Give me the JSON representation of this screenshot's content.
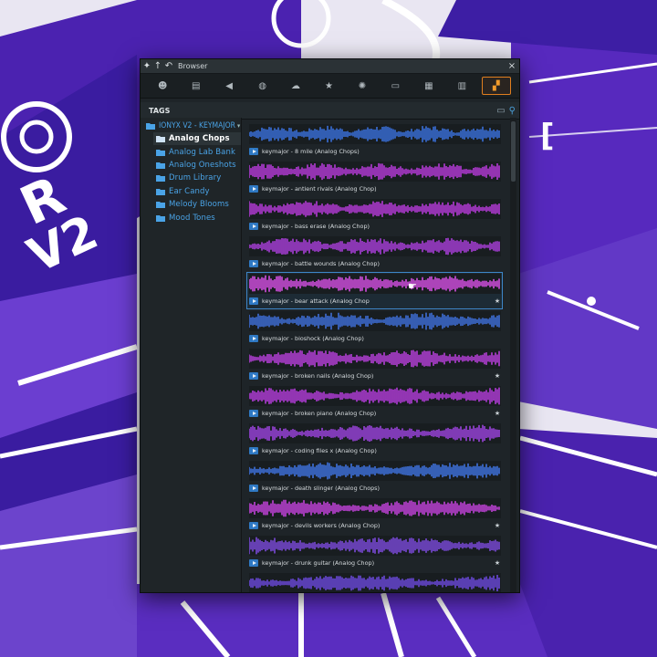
{
  "window": {
    "title": "Browser",
    "close_label": "×"
  },
  "titlebar_icons": [
    {
      "name": "pin-icon",
      "glyph": "✦"
    },
    {
      "name": "up-arrow-icon",
      "glyph": "↑"
    },
    {
      "name": "back-icon",
      "glyph": "↶"
    }
  ],
  "toolbar": [
    {
      "name": "smiley-icon",
      "glyph": "☻",
      "active": false
    },
    {
      "name": "document-icon",
      "glyph": "▤",
      "active": false
    },
    {
      "name": "speaker-icon",
      "glyph": "◀",
      "active": false
    },
    {
      "name": "globe-icon",
      "glyph": "◍",
      "active": false
    },
    {
      "name": "cloud-icon",
      "glyph": "☁",
      "active": false
    },
    {
      "name": "star-icon",
      "glyph": "★",
      "active": false
    },
    {
      "name": "plugin-icon",
      "glyph": "✺",
      "active": false
    },
    {
      "name": "folder-icon",
      "glyph": "▭",
      "active": false
    },
    {
      "name": "film-icon",
      "glyph": "▦",
      "active": false
    },
    {
      "name": "keyboard-icon",
      "glyph": "▥",
      "active": false
    },
    {
      "name": "grid-icon",
      "glyph": "▞",
      "active": true
    }
  ],
  "tags_bar": {
    "label": "TAGS",
    "folder_glyph": "▭",
    "search_glyph": "⚲"
  },
  "tree": {
    "root": "IONYX V2 - KEYMAJOR",
    "items": [
      {
        "label": "Analog Chops",
        "selected": true
      },
      {
        "label": "Analog Lab Bank",
        "selected": false
      },
      {
        "label": "Analog Oneshots",
        "selected": false
      },
      {
        "label": "Drum Library",
        "selected": false
      },
      {
        "label": "Ear Candy",
        "selected": false
      },
      {
        "label": "Melody Blooms",
        "selected": false
      },
      {
        "label": "Mood Tones",
        "selected": false
      }
    ]
  },
  "samples": [
    {
      "name": "keymajor - 8 mile (Analog Chops)",
      "starred": false,
      "color": "#3a6fd8"
    },
    {
      "name": "keymajor - antient rivals (Analog Chop)",
      "starred": false,
      "color": "#b43bd6"
    },
    {
      "name": "keymajor - bass erase (Analog Chop)",
      "starred": false,
      "color": "#b43bd6"
    },
    {
      "name": "keymajor - battle wounds (Analog Chop)",
      "starred": false,
      "color": "#a83ed8"
    },
    {
      "name": "keymajor - bear attack (Analog Chop",
      "starred": true,
      "color": "#d24fe0",
      "selected": true
    },
    {
      "name": "keymajor - bioshock (Analog Chop)",
      "starred": false,
      "color": "#3f6ed6"
    },
    {
      "name": "keymajor - broken nails (Analog Chop)",
      "starred": true,
      "color": "#b53fd8"
    },
    {
      "name": "keymajor - broken piano (Analog Chop)",
      "starred": true,
      "color": "#b23cd8"
    },
    {
      "name": "keymajor - coding files x (Analog Chop)",
      "starred": false,
      "color": "#9a43dc"
    },
    {
      "name": "keymajor - death slinger (Analog Chops)",
      "starred": false,
      "color": "#3f71dc"
    },
    {
      "name": "keymajor - devils workers (Analog Chop)",
      "starred": true,
      "color": "#c042d8"
    },
    {
      "name": "keymajor - drunk guitar (Analog Chop)",
      "starred": true,
      "color": "#7a4ad8"
    },
    {
      "name": "",
      "starred": false,
      "color": "#6a48d8"
    }
  ]
}
